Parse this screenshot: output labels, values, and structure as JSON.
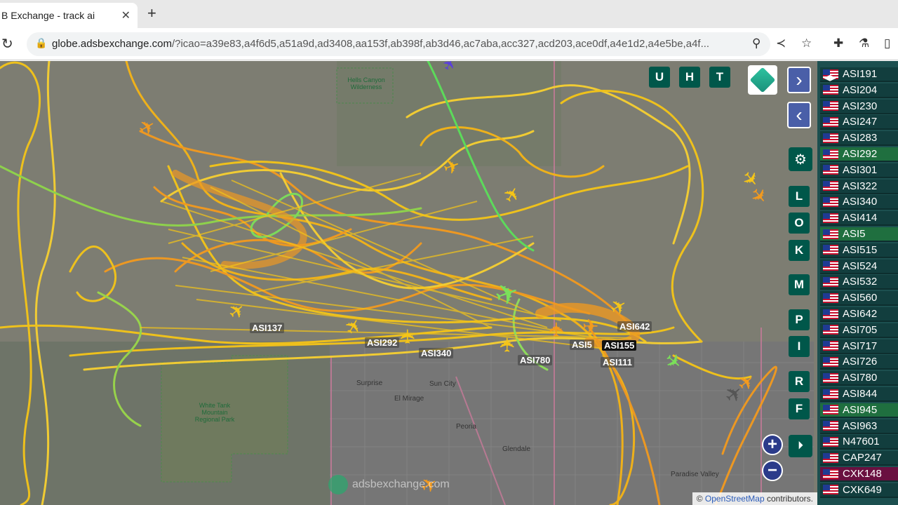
{
  "browser": {
    "tab_title": "B Exchange - track ai",
    "tab_close": "✕",
    "new_tab": "+",
    "url_host": "globe.adsbexchange.com",
    "url_path": "/?icao=a39e83,a4f6d5,a51a9d,ad3408,aa153f,ab398f,ab3d46,ac7aba,acc327,acd203,ace0df,a4e1d2,a4e5be,a4f..."
  },
  "map": {
    "buttons_top": [
      "U",
      "H",
      "T"
    ],
    "buttons_side": [
      "L",
      "O",
      "K",
      "M",
      "P",
      "I",
      "R",
      "F"
    ],
    "zoom_in": "+",
    "zoom_out": "−",
    "watermark": "adsbexchange.com",
    "attribution_prefix": "©",
    "attribution_link": "OpenStreetMap",
    "attribution_suffix": "contributors.",
    "place_labels": {
      "hells_canyon": "Hells Canyon Wilderness",
      "white_tank": "White Tank Mountain Regional Park",
      "surprise": "Surprise",
      "sun_city": "Sun City",
      "el_mirage": "El Mirage",
      "peoria": "Peoria",
      "glendale": "Glendale",
      "paradise_valley": "Paradise Valley"
    },
    "aircraft_labels": [
      "ASI137",
      "ASI292",
      "ASI340",
      "ASI780",
      "ASI642",
      "ASI5",
      "ASI155",
      "ASI111"
    ]
  },
  "sidebar": {
    "rows": [
      {
        "callsign": "ASI191",
        "status": "normal"
      },
      {
        "callsign": "ASI204",
        "status": "normal"
      },
      {
        "callsign": "ASI230",
        "status": "normal"
      },
      {
        "callsign": "ASI247",
        "status": "normal"
      },
      {
        "callsign": "ASI283",
        "status": "normal"
      },
      {
        "callsign": "ASI292",
        "status": "green"
      },
      {
        "callsign": "ASI301",
        "status": "normal"
      },
      {
        "callsign": "ASI322",
        "status": "normal"
      },
      {
        "callsign": "ASI340",
        "status": "normal"
      },
      {
        "callsign": "ASI414",
        "status": "normal"
      },
      {
        "callsign": "ASI5",
        "status": "green"
      },
      {
        "callsign": "ASI515",
        "status": "normal"
      },
      {
        "callsign": "ASI524",
        "status": "normal"
      },
      {
        "callsign": "ASI532",
        "status": "normal"
      },
      {
        "callsign": "ASI560",
        "status": "normal"
      },
      {
        "callsign": "ASI642",
        "status": "normal"
      },
      {
        "callsign": "ASI705",
        "status": "normal"
      },
      {
        "callsign": "ASI717",
        "status": "normal"
      },
      {
        "callsign": "ASI726",
        "status": "normal"
      },
      {
        "callsign": "ASI780",
        "status": "normal"
      },
      {
        "callsign": "ASI844",
        "status": "normal"
      },
      {
        "callsign": "ASI945",
        "status": "green"
      },
      {
        "callsign": "ASI963",
        "status": "normal"
      },
      {
        "callsign": "N47601",
        "status": "normal"
      },
      {
        "callsign": "CAP247",
        "status": "normal"
      },
      {
        "callsign": "CXK148",
        "status": "purple"
      },
      {
        "callsign": "CXK649",
        "status": "normal"
      }
    ]
  },
  "colors": {
    "track_yellow": "#f5c518",
    "track_orange": "#f39a1e",
    "track_green": "#7be05a",
    "button_teal": "#00574a",
    "sidebar_bg": "#1c4f4f"
  },
  "icons": [
    "lock-icon",
    "reload-icon",
    "location-pin-icon",
    "share-icon",
    "star-icon",
    "extensions-icon",
    "profile-icon",
    "sidepanel-icon",
    "layers-icon",
    "gear-icon",
    "chevron-right-icon",
    "chevron-left-icon",
    "replay-icon",
    "airplane-icon"
  ]
}
